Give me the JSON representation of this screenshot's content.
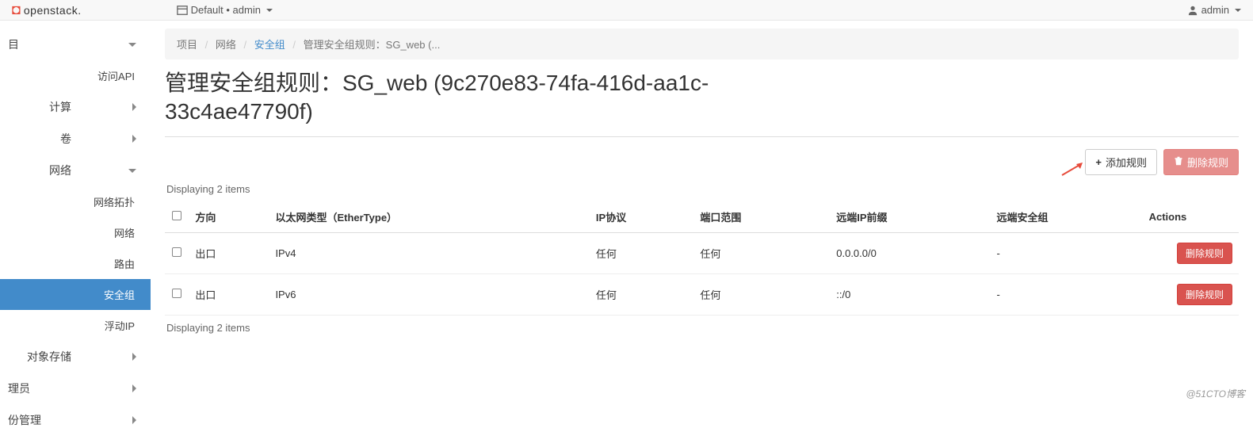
{
  "topbar": {
    "logo_text": "openstack.",
    "context": "Default • admin",
    "user": "admin"
  },
  "sidebar": {
    "proj_char": "目",
    "api": "访问API",
    "compute": "计算",
    "volumes": "卷",
    "network": "网络",
    "topology": "网络拓扑",
    "networks": "网络",
    "routers": "路由",
    "secgroups": "安全组",
    "floatingip": "浮动IP",
    "objstore": "对象存储",
    "admin": "理员",
    "idmgmt": "份管理"
  },
  "breadcrumb": {
    "b1": "项目",
    "b2": "网络",
    "b3": "安全组",
    "b4": "管理安全组规则：SG_web (..."
  },
  "page_title": "管理安全组规则：SG_web (9c270e83-74fa-416d-aa1c-33c4ae47790f)",
  "actions": {
    "add": "添加规则",
    "del": "删除规则"
  },
  "display_count": "Displaying 2 items",
  "table": {
    "headers": {
      "direction": "方向",
      "ethertype": "以太网类型（EtherType）",
      "proto": "IP协议",
      "port": "端口范围",
      "remoteip": "远端IP前缀",
      "remotesg": "远端安全组",
      "actions": "Actions"
    },
    "rows": [
      {
        "direction": "出口",
        "ethertype": "IPv4",
        "proto": "任何",
        "port": "任何",
        "remoteip": "0.0.0.0/0",
        "remotesg": "-",
        "action": "删除规则"
      },
      {
        "direction": "出口",
        "ethertype": "IPv6",
        "proto": "任何",
        "port": "任何",
        "remoteip": "::/0",
        "remotesg": "-",
        "action": "删除规则"
      }
    ]
  },
  "watermark": "@51CTO博客"
}
